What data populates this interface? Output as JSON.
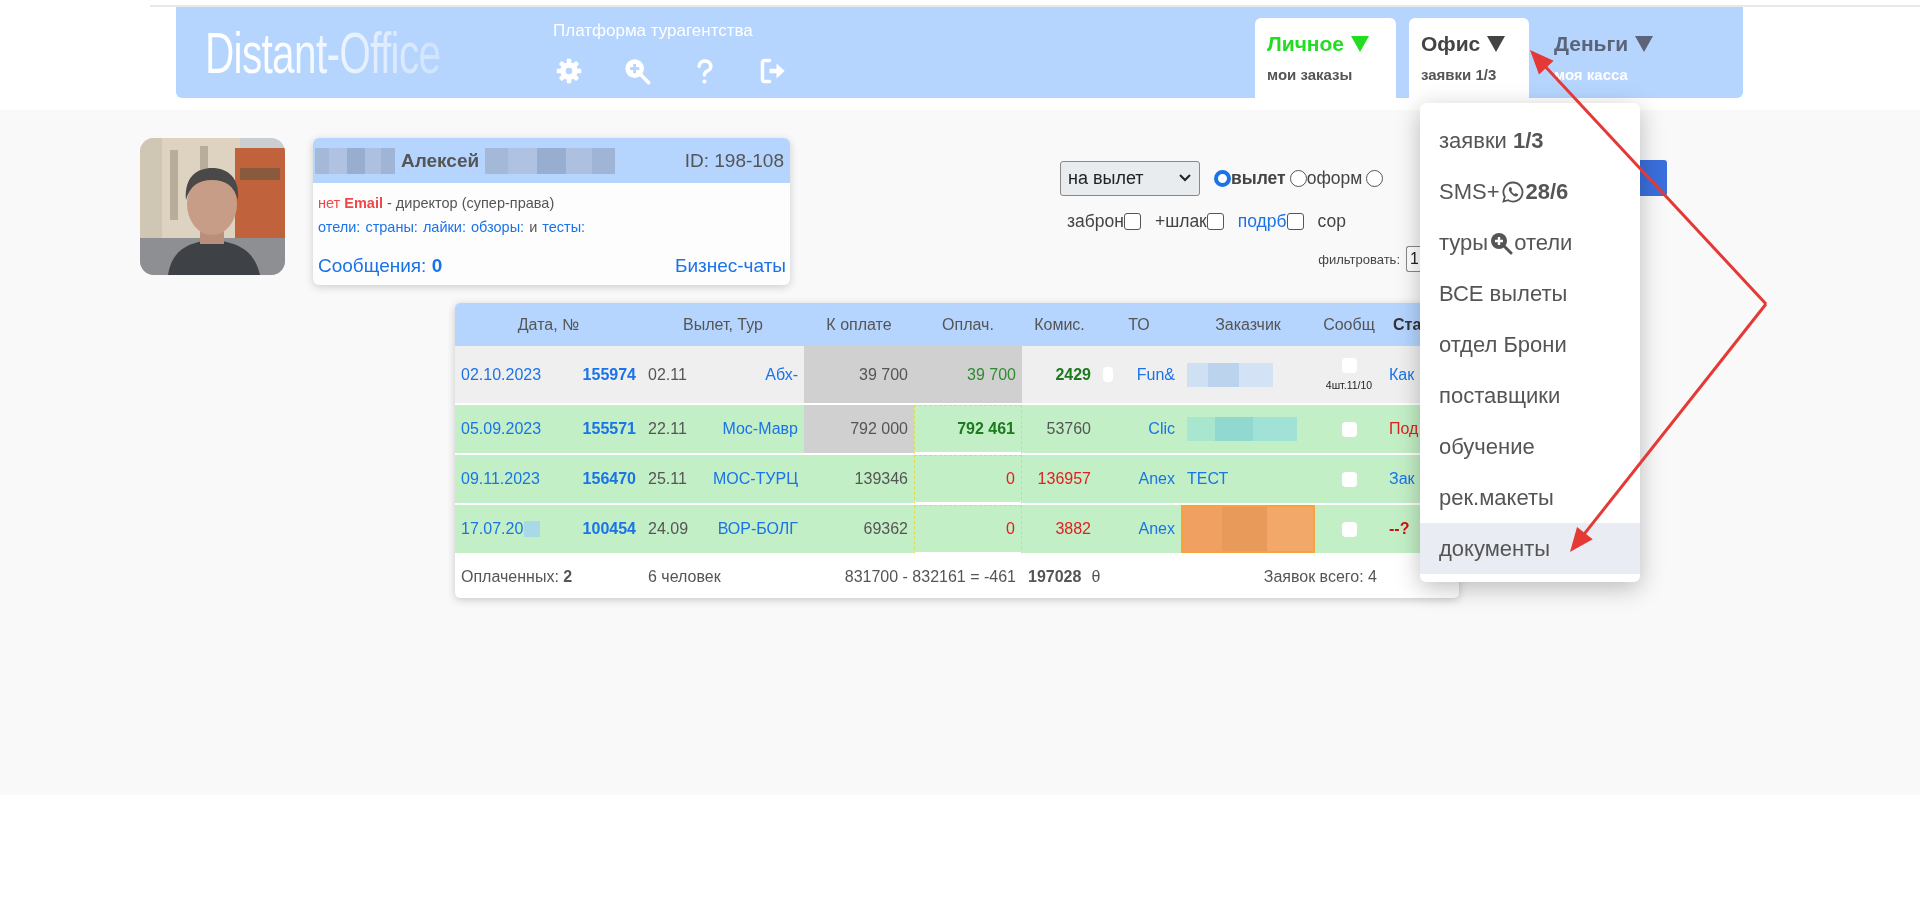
{
  "header": {
    "logo": "Distant-Office",
    "platform": "Платформа турагентства",
    "tools": [
      {
        "kind": "settings"
      },
      {
        "kind": "zoom"
      },
      {
        "kind": "help"
      },
      {
        "kind": "logout"
      }
    ],
    "tabs": [
      {
        "label": "Личное",
        "sub": "мои заказы",
        "active": true,
        "color": "#22dd22"
      },
      {
        "label": "Офис",
        "sub": "заявки 1/3",
        "active": true,
        "color": "#444444"
      },
      {
        "label": "Деньги",
        "sub": "моя касса",
        "active": false,
        "color": "#5b6478"
      }
    ]
  },
  "profile": {
    "name_parts": [
      {
        "kind": "redacted"
      },
      {
        "kind": "name",
        "text": "Алексей"
      },
      {
        "kind": "redacted"
      }
    ],
    "id": "ID: 198-108",
    "role_parts": [
      {
        "kind": "warning",
        "text": "нет"
      },
      {
        "kind": "warning-strong",
        "text": "Email"
      },
      {
        "kind": "plain",
        "text": "- директор (супер-права)"
      }
    ],
    "links": [
      {
        "kind": "link",
        "text": "отели:"
      },
      {
        "kind": "link",
        "text": "страны:"
      },
      {
        "kind": "link",
        "text": "лайки:"
      },
      {
        "kind": "link",
        "text": "обзоры:"
      },
      {
        "kind": "plain",
        "text": "и"
      },
      {
        "kind": "link",
        "text": "тесты:"
      }
    ],
    "messages": "Сообщения: **0**",
    "chats": "Бизнес-чаты"
  },
  "filters": {
    "select": {
      "value": "на вылет"
    },
    "radios": [
      {
        "label": "вылет",
        "selected": true
      },
      {
        "label": "оформ",
        "selected": false
      },
      {
        "selected": false
      }
    ],
    "button": {
      "kind": "submit"
    },
    "checks": [
      {
        "label": "заброн",
        "kind": "plain",
        "checked": false
      },
      {
        "label": "+шлак",
        "kind": "plain",
        "checked": false
      },
      {
        "label": "подрб",
        "kind": "link",
        "checked": false
      }
    ],
    "cut_label": "сор",
    "filter_label": "фильтровать:",
    "filter_value": "1"
  },
  "table": {
    "columns": [
      {
        "label": "Дата, №",
        "bold": false
      },
      {
        "label": "Вылет, Тур",
        "bold": false
      },
      {
        "label": "К оплате",
        "bold": false
      },
      {
        "label": "Оплач.",
        "bold": false
      },
      {
        "label": "Комис.",
        "bold": false
      },
      {
        "label": "ТО",
        "bold": false
      },
      {
        "label": "Заказчик",
        "bold": false
      },
      {
        "label": "Сообщ",
        "bold": false
      },
      {
        "label": "Ста",
        "bold": true
      }
    ],
    "rows": [
      {
        "highlighted": false,
        "date": "02.10.2023",
        "number": "155974",
        "departure": "02.11",
        "tour": "Абх-",
        "to_pay": "39 700",
        "to_pay_shaded": true,
        "paid": "39 700",
        "paid_shaded": true,
        "paid_dotted": false,
        "paid_bold": false,
        "paid_alert": false,
        "commission": "2429",
        "commission_bold": true,
        "commission_alert": false,
        "flag": {
          "checked": false
        },
        "operator": "Fun&",
        "customer": {
          "redacted": true,
          "highlight": false
        },
        "message": {
          "checked": false,
          "note": "4шт.11/10"
        },
        "status": "Как",
        "status_alert": false,
        "status_bold": false
      },
      {
        "highlighted": true,
        "date": "05.09.2023",
        "number": "155571",
        "departure": "22.11",
        "tour": "Мос-Мавр",
        "to_pay": "792 000",
        "to_pay_shaded": true,
        "paid": "792 461",
        "paid_shaded": false,
        "paid_dotted": true,
        "paid_bold": true,
        "paid_alert": false,
        "commission": "53760",
        "commission_bold": false,
        "commission_alert": false,
        "operator": "Clic",
        "customer": {
          "redacted": true,
          "highlight": false
        },
        "message": {
          "checked": false
        },
        "status": "Под",
        "status_alert": true,
        "status_bold": false
      },
      {
        "highlighted": true,
        "date": "09.11.2023",
        "number": "156470",
        "departure": "25.11",
        "tour": "МОС-ТУРЦ",
        "to_pay": "139346",
        "to_pay_shaded": false,
        "paid": "0",
        "paid_shaded": false,
        "paid_dotted": true,
        "paid_bold": false,
        "paid_alert": true,
        "commission": "136957",
        "commission_bold": false,
        "commission_alert": true,
        "operator": "Anex",
        "customer": {
          "text": "ТЕСТ",
          "redacted": false,
          "highlight": false
        },
        "message": {
          "checked": false
        },
        "status": "Зак",
        "status_alert": false,
        "status_bold": false
      },
      {
        "highlighted": true,
        "date": "17.07.20",
        "date_redacted": true,
        "number": "100454",
        "departure": "24.09",
        "tour": "ВОР-БОЛГ",
        "to_pay": "69362",
        "to_pay_shaded": false,
        "paid": "0",
        "paid_shaded": false,
        "paid_dotted": true,
        "paid_bold": false,
        "paid_alert": true,
        "commission": "3882",
        "commission_bold": false,
        "commission_alert": true,
        "operator": "Anex",
        "customer": {
          "redacted": true,
          "highlight": true
        },
        "message": {
          "checked": false
        },
        "status": "--?",
        "status_alert": true,
        "status_bold": true
      }
    ],
    "footer": {
      "paid_count": "Оплаченных: **2**",
      "people": "6 человек",
      "balance": "831700 - 832161 = -461",
      "commission_total": "197028",
      "theta": "θ",
      "total": "Заявок всего: 4"
    }
  },
  "menu": {
    "items": [
      {
        "kind": "text",
        "text": "заявки **1/3**",
        "highlighted": false
      },
      {
        "kind": "messages",
        "text": "SMS+",
        "after": "**28/6**",
        "highlighted": false
      },
      {
        "kind": "search",
        "text": "туры",
        "after": "отели",
        "highlighted": false
      },
      {
        "kind": "text",
        "text": "ВСЕ вылеты",
        "highlighted": false
      },
      {
        "kind": "text",
        "text": "отдел Брони",
        "highlighted": false
      },
      {
        "kind": "text",
        "text": "поставщики",
        "highlighted": false
      },
      {
        "kind": "text",
        "text": "обучение",
        "highlighted": false
      },
      {
        "kind": "text",
        "text": "рек.макеты",
        "highlighted": false
      },
      {
        "kind": "text",
        "text": "документы",
        "highlighted": true
      }
    ]
  },
  "annotations": [
    {
      "kind": "arrow"
    },
    {
      "kind": "arrow"
    }
  ]
}
